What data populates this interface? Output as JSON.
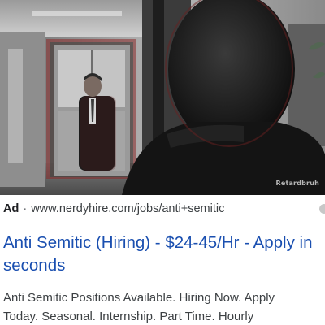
{
  "video": {
    "watermark": "Retardbruh"
  },
  "ad": {
    "label": "Ad",
    "separator": "·",
    "url": "www.nerdyhire.com/jobs/anti+semitic",
    "title": "Anti Semitic (Hiring) - $24-45/Hr - Apply in seconds",
    "description_line1": "Anti Semitic Positions Available. Hiring Now. Apply",
    "description_line2": "Today. Seasonal. Internship. Part Time. Hourly",
    "title_color": "#1a4fb0",
    "text_color": "#3c4043"
  }
}
